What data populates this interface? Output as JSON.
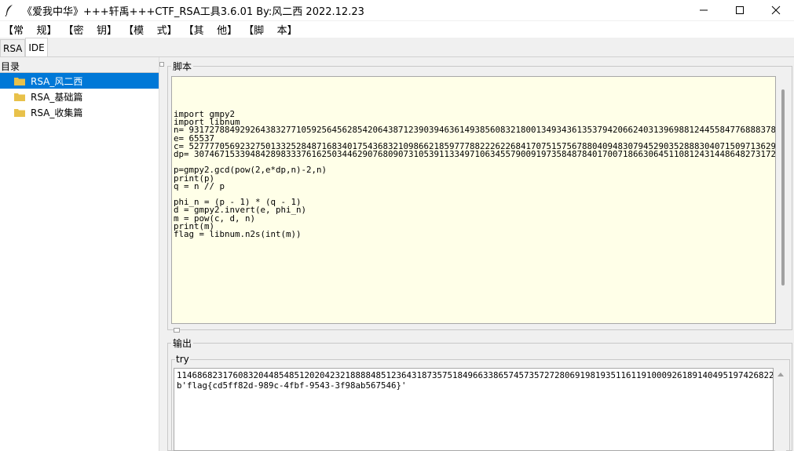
{
  "window": {
    "title": "《爱我中华》+++轩禹+++CTF_RSA工具3.6.01    By:风二西 2022.12.23"
  },
  "menu": [
    "【常    规】",
    "【密    钥】",
    "【模    式】",
    "【其    他】",
    "【脚    本】"
  ],
  "tabs": [
    "RSA",
    "IDE"
  ],
  "directory": {
    "label": "目录",
    "items": [
      "RSA_风二西",
      "RSA_基础篇",
      "RSA_收集篇"
    ]
  },
  "script": {
    "label": "脚本",
    "code": "import gmpy2\nimport libnum\nn= 93172788492926438327710592564562854206438712390394636149385608321800134934361353794206624031396988124455847768883785503795521389178814791213054124361007887496351504099772757164211666778414800698976335767027868761735533195880182982358937211282541379697714874313863354097646233575265223978310932841461535936931\ne= 65537\nc= 52777705692327501332528487168340175436832109866218597778822262268417075157567880409483079452903528883040715097136293765188858187142103081639134055997552543213589467751037524482578093572244313928030341356359989531451789166815462417484822009937089058352982739611755717666799278271494933382716633553199739292089\ndp= 30746715339484289833376162503446290768090731053911334971063455790091973584878401700718663064511081243144864827317281761977546696714560876926057361522163 5\n\np=gmpy2.gcd(pow(2,e*dp,n)-2,n)\nprint(p)\nq = n // p\n\nphi_n = (p - 1) * (q - 1)\nd = gmpy2.invert(e, phi_n)\nm = pow(c, d, n)\nprint(m)\nflag = libnum.n2s(int(m))"
  },
  "output": {
    "label": "输出",
    "group_label": "try",
    "text": "11468682317608320448548512020423218888485123643187357518496633865745735727280691981935116119100092618914049519742682239518908638510291506084862277348934564356006392793428524507560168372954901489472646059358818583759303257992608877839479942747202608499537533\nb'flag{cd5ff82d-989c-4fbf-9543-3f98ab567546}'"
  },
  "colors": {
    "selected": "#0078d7",
    "editor_bg": "#ffffe8",
    "folder": "#e8c14a"
  }
}
